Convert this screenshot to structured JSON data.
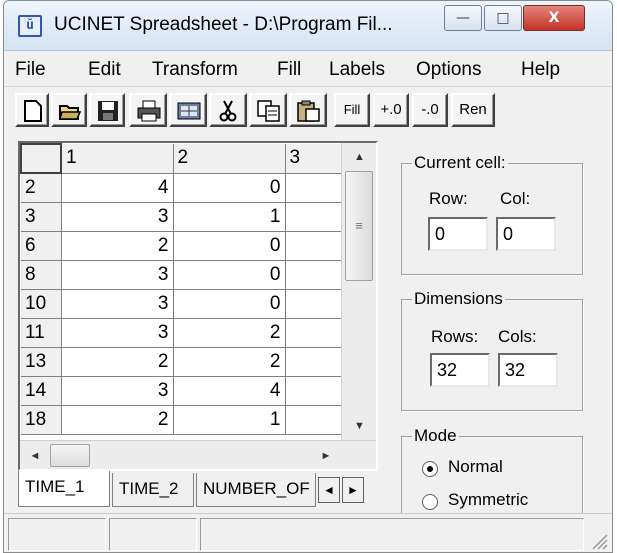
{
  "window": {
    "title": "UCINET Spreadsheet - D:\\Program Fil...",
    "icon": "ucinet-app-icon",
    "app_icon_glyph": "ŭ",
    "controls": {
      "minimize": "—",
      "maximize": "□",
      "close": "X"
    }
  },
  "menu": [
    "File",
    "Edit",
    "Transform",
    "Fill",
    "Labels",
    "Options",
    "Help"
  ],
  "toolbar": {
    "icons": [
      "new-document-icon",
      "open-folder-icon",
      "save-disk-icon",
      "print-icon",
      "matrix-icon",
      "cut-scissors-icon",
      "copy-icon",
      "paste-icon"
    ],
    "fill_label": "Fill",
    "plus_zero_label": "+.0",
    "minus_zero_label": "-.0",
    "ren_label": "Ren"
  },
  "grid": {
    "columns": [
      "",
      "1",
      "2",
      "3"
    ],
    "rows": [
      {
        "label": "2",
        "c1": "4",
        "c2": "0",
        "c3": ""
      },
      {
        "label": "3",
        "c1": "3",
        "c2": "1",
        "c3": ""
      },
      {
        "label": "6",
        "c1": "2",
        "c2": "0",
        "c3": ""
      },
      {
        "label": "8",
        "c1": "3",
        "c2": "0",
        "c3": ""
      },
      {
        "label": "10",
        "c1": "3",
        "c2": "0",
        "c3": ""
      },
      {
        "label": "11",
        "c1": "3",
        "c2": "2",
        "c3": ""
      },
      {
        "label": "13",
        "c1": "2",
        "c2": "2",
        "c3": ""
      },
      {
        "label": "14",
        "c1": "3",
        "c2": "4",
        "c3": ""
      },
      {
        "label": "18",
        "c1": "2",
        "c2": "1",
        "c3": ""
      }
    ],
    "scroll": {
      "up": "▲",
      "down": "▼",
      "left": "◄",
      "right": "►",
      "grip": "≡"
    }
  },
  "sheet_tabs": [
    "TIME_1",
    "TIME_2",
    "NUMBER_OF"
  ],
  "tab_scroll": {
    "left": "◄",
    "right": "►"
  },
  "current_cell": {
    "legend": "Current cell:",
    "row_label": "Row:",
    "col_label": "Col:",
    "row_value": "0",
    "col_value": "0"
  },
  "dimensions": {
    "legend": "Dimensions",
    "rows_label": "Rows:",
    "cols_label": "Cols:",
    "rows_value": "32",
    "cols_value": "32"
  },
  "mode": {
    "legend": "Mode",
    "options": [
      "Normal",
      "Symmetric"
    ],
    "selected": "Normal"
  },
  "statusbar": {
    "cells": [
      "",
      "",
      ""
    ]
  }
}
